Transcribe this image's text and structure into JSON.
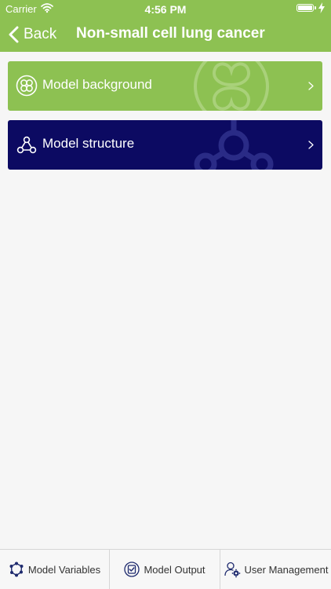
{
  "status_bar": {
    "carrier": "Carrier",
    "time": "4:56 PM",
    "wifi_icon": "wifi-icon",
    "battery_icon": "battery-icon",
    "charging_icon": "bolt-icon"
  },
  "nav": {
    "back_label": "Back",
    "title": "Non-small cell lung cancer"
  },
  "cards": [
    {
      "label": "Model background",
      "icon": "clover-icon",
      "color": "#8dc152"
    },
    {
      "label": "Model structure",
      "icon": "network-icon",
      "color": "#0c0a62"
    }
  ],
  "tabbar": {
    "tabs": [
      {
        "label": "Model Variables",
        "icon": "molecule-icon"
      },
      {
        "label": "Model Output",
        "icon": "check-clipboard-icon"
      },
      {
        "label": "User Management",
        "icon": "user-gear-icon"
      }
    ]
  },
  "colors": {
    "accent_green": "#8dc152",
    "navy": "#0c0a62",
    "background": "#f6f6f6"
  }
}
